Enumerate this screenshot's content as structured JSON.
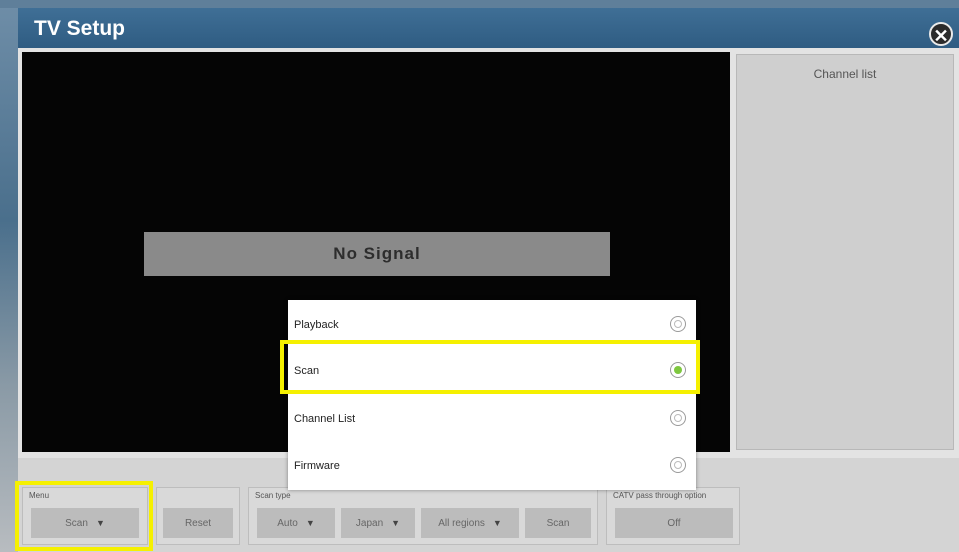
{
  "window": {
    "title": "TV Setup",
    "close_glyph": "✕"
  },
  "video": {
    "status_text": "No Signal"
  },
  "channel_panel": {
    "title": "Channel list"
  },
  "bottom": {
    "menu": {
      "label": "Menu",
      "value": "Scan"
    },
    "reset_label": "Reset",
    "scan_type": {
      "label": "Scan type",
      "mode": "Auto",
      "country": "Japan",
      "region": "All regions",
      "scan_button": "Scan"
    },
    "catv": {
      "label": "CATV pass through option",
      "value": "Off"
    }
  },
  "menu_popup": {
    "items": [
      {
        "label": "Playback",
        "selected": false
      },
      {
        "label": "Scan",
        "selected": true
      },
      {
        "label": "Channel List",
        "selected": false
      },
      {
        "label": "Firmware",
        "selected": false
      }
    ]
  },
  "colors": {
    "highlight": "#f5f000",
    "radio_selected": "#7ec73f",
    "titlebar": "#2f5c82"
  }
}
